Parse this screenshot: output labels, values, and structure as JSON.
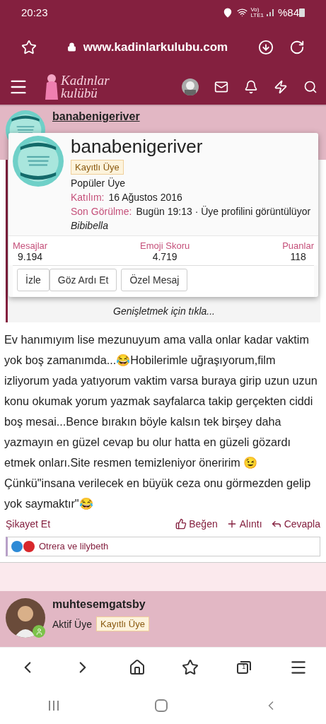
{
  "status_bar": {
    "time": "20:23",
    "network": [
      "Vo)",
      "LTE1"
    ],
    "battery": "%84"
  },
  "browser": {
    "url": "www.kadinlarkulubu.com",
    "tab_count": "1"
  },
  "site": {
    "logo": [
      "Kadınlar",
      "kulübü"
    ]
  },
  "post": {
    "author": "banabenigeriver",
    "popup": {
      "name": "banabenigeriver",
      "badge": "Kayıtlı Üye",
      "title": "Popüler Üye",
      "joined_label": "Katılım:",
      "joined": "16 Ağustos 2016",
      "seen_label": "Son Görülme:",
      "seen": "Bugün 19:13 · Üye profilini görüntülüyor",
      "seen_user": "Bibibella",
      "stats": [
        {
          "label": "Mesajlar",
          "value": "9.194"
        },
        {
          "label": "Emoji Skoru",
          "value": "4.719"
        },
        {
          "label": "Puanlar",
          "value": "118"
        }
      ],
      "buttons": [
        {
          "label": "İzle",
          "group": true
        },
        {
          "label": "Göz Ardı Et",
          "group": true
        },
        {
          "label": "Özel Mesaj",
          "group": false
        }
      ]
    },
    "expand": "Genişletmek için tıkla...",
    "body": "Ev hanımıyım lise mezunuyum ama valla onlar kadar vaktim yok boş zamanımda...😂Hobilerimle uğraşıyorum,film izliyorum yada yatıyorum vaktim varsa buraya girip uzun uzun konu okumak yorum yazmak sayfalarca takip gerçekten ciddi boş mesai...Bence bırakın böyle kalsın tek birşey daha yazmayın en güzel cevap bu olur hatta en güzeli gözardı etmek onları.Site resmen temizleniyor öneririm 😉 Çünkü\"insana verilecek en büyük ceza onu görmezden gelip yok saymaktır\"😂",
    "report": "Şikayet Et",
    "actions": [
      {
        "kind": "like",
        "label": "Beğen"
      },
      {
        "kind": "quote",
        "label": "Alıntı"
      },
      {
        "kind": "reply",
        "label": "Cevapla"
      }
    ],
    "reactions": "Otrera ve lilybeth"
  },
  "next_post": {
    "author": "muhtesemgatsby",
    "title": "Aktif Üye",
    "badge": "Kayıtlı Üye",
    "online": true
  }
}
